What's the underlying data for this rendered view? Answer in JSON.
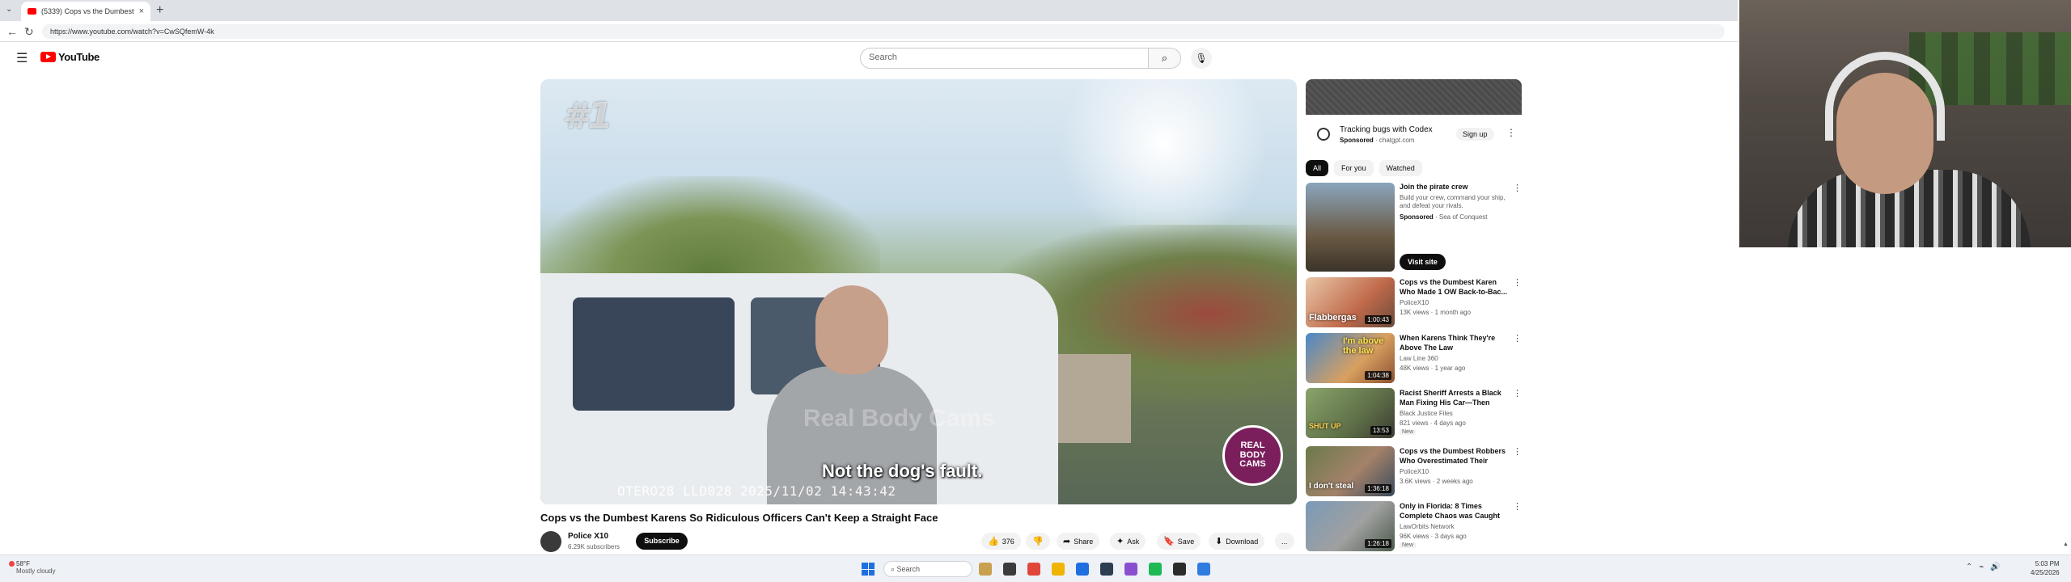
{
  "browser": {
    "tab_title": "(5339) Cops vs the Dumbest",
    "tab_close": "×",
    "new_tab": "+",
    "url": "https://www.youtube.com/watch?v=CwSQfemW-4k"
  },
  "header": {
    "logo_text": "YouTube",
    "search_placeholder": "Search"
  },
  "player": {
    "overlay_badge": "#1",
    "watermark": "Real Body Cams",
    "caption": "Not the dog's fault.",
    "timestamp": "OTERO28 LLD028  2025/11/02  14:43:42",
    "channel_logo": "REAL BODY CAMS"
  },
  "video": {
    "title": "Cops vs the Dumbest Karens So Ridiculous Officers Can't Keep a Straight Face",
    "owner_name": "Police X10",
    "owner_subs": "6.29K subscribers",
    "subscribe_label": "Subscribe",
    "like_count": "376",
    "share_label": "Share",
    "ask_label": "Ask",
    "save_label": "Save",
    "download_label": "Download",
    "more_label": "..."
  },
  "sidebar": {
    "ad": {
      "title": "Tracking bugs with Codex",
      "sponsored_label": "Sponsored",
      "sponsor_domain": "chatgpt.com",
      "signup_label": "Sign up"
    },
    "chips": [
      "All",
      "For you",
      "Watched"
    ],
    "promo": {
      "title": "Join the pirate crew",
      "description": "Build your crew, command your ship, and defeat your rivals.",
      "sponsored_label": "Sponsored",
      "sponsor_name": "Sea of Conquest",
      "visit_label": "Visit site"
    },
    "recommendations": [
      {
        "title": "Cops vs the Dumbest Karen Who Made 1 OW Back-to-Bac...",
        "channel": "PoliceX10",
        "stats": "13K views · 1 month ago",
        "duration": "1:00:43",
        "overlay": "Flabbergas",
        "badge": ""
      },
      {
        "title": "When Karens Think They're Above The Law",
        "channel": "Law Line 360",
        "stats": "48K views · 1 year ago",
        "duration": "1:04:38",
        "overlay": "I'm above the law",
        "badge": ""
      },
      {
        "title": "Racist Sheriff Arrests a Black Man Fixing His Car—Then Lea...",
        "channel": "Black Justice Files",
        "stats": "821 views · 4 days ago",
        "duration": "13:53",
        "overlay": "SHUT UP",
        "badge": "New"
      },
      {
        "title": "Cops vs the Dumbest Robbers Who Overestimated Their Own...",
        "channel": "PoliceX10",
        "stats": "3.6K views · 2 weeks ago",
        "duration": "1:36:18",
        "overlay": "I don't steal",
        "badge": ""
      },
      {
        "title": "Only in Florida: 8 Times Complete Chaos was Caught o...",
        "channel": "LawOrbits Network",
        "stats": "96K views · 3 days ago",
        "duration": "1:26:18",
        "overlay": "",
        "badge": "New"
      }
    ]
  },
  "taskbar": {
    "weather_temp": "58°F",
    "weather_cond": "Mostly cloudy",
    "search_placeholder": "Search",
    "time": "5:03 PM",
    "date": "4/25/2026"
  },
  "colors": {
    "brand_red": "#ff0000",
    "text_primary": "#0f0f0f",
    "text_secondary": "#606060",
    "chip_bg": "#f2f2f2"
  }
}
